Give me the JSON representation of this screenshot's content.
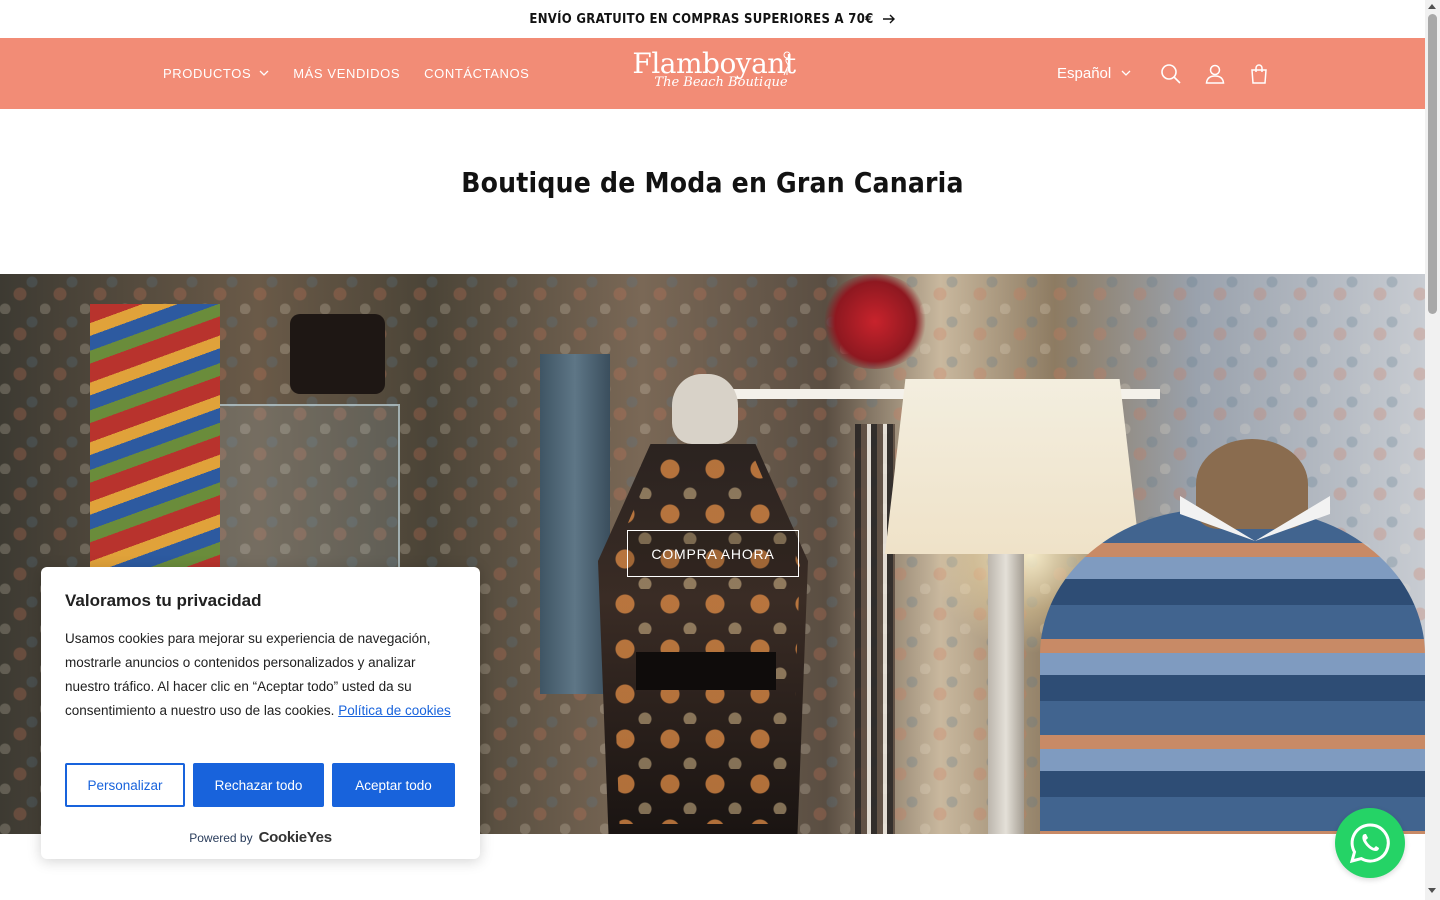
{
  "announcement": {
    "text": "ENVÍO GRATUITO EN COMPRAS SUPERIORES A 70€",
    "icon": "arrow-right-icon"
  },
  "header": {
    "background": "#f28c76",
    "nav": [
      {
        "label": "PRODUCTOS",
        "has_dropdown": true
      },
      {
        "label": "MÁS VENDIDOS",
        "has_dropdown": false
      },
      {
        "label": "CONTÁCTANOS",
        "has_dropdown": false
      }
    ],
    "logo": {
      "main": "Flamboyant",
      "sub": "The Beach Boutique"
    },
    "language": "Español",
    "icons": [
      "search-icon",
      "account-icon",
      "cart-icon"
    ]
  },
  "page": {
    "title": "Boutique de Moda en Gran Canaria"
  },
  "hero": {
    "cta_label": "COMPRA AHORA"
  },
  "cookie_banner": {
    "title": "Valoramos tu privacidad",
    "text": "Usamos cookies para mejorar su experiencia de navegación, mostrarle anuncios o contenidos personalizados y analizar nuestro tráfico. Al hacer clic en “Aceptar todo” usted da su consentimiento a nuestro uso de las cookies.",
    "policy_link": "Política de cookies",
    "buttons": {
      "customize": "Personalizar",
      "reject": "Rechazar todo",
      "accept": "Aceptar todo"
    },
    "powered_by": "Powered by",
    "brand": "CookieYes",
    "accent": "#1863dc"
  },
  "whatsapp": {
    "icon": "whatsapp-icon",
    "color": "#25d366"
  }
}
